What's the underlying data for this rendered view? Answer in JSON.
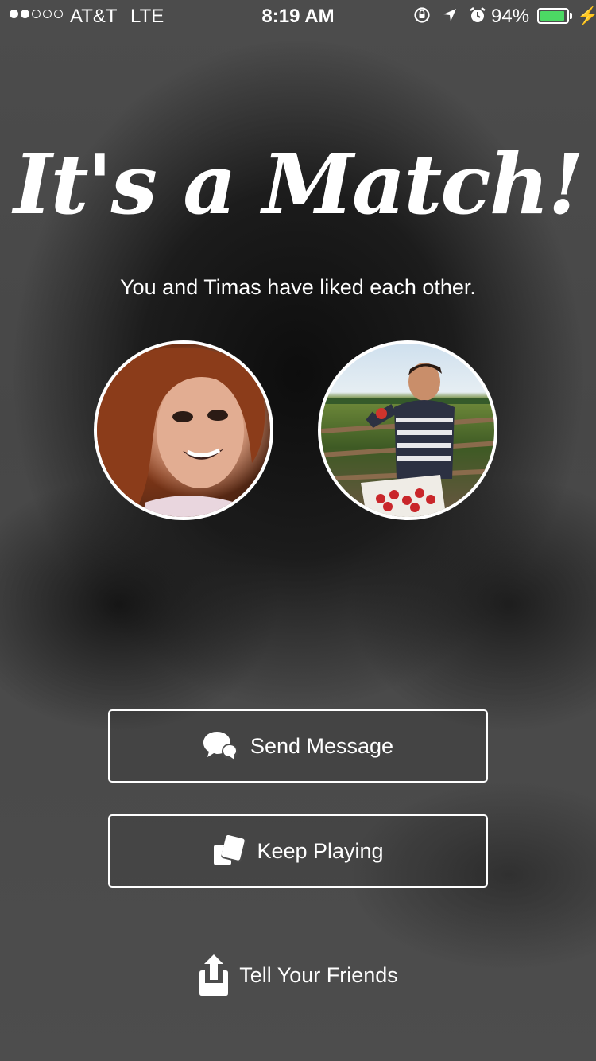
{
  "status_bar": {
    "carrier": "AT&T",
    "network": "LTE",
    "time": "8:19 AM",
    "battery_percent": "94%",
    "battery_level": 0.94,
    "signal_bars_filled": 2,
    "signal_bars_total": 5
  },
  "match": {
    "title": "It's a Match!",
    "subtitle": "You and Timas have liked each other."
  },
  "actions": {
    "send_message": "Send Message",
    "keep_playing": "Keep Playing",
    "tell_friends": "Tell Your Friends"
  },
  "colors": {
    "battery_fill": "#4cd964",
    "text": "#ffffff"
  }
}
